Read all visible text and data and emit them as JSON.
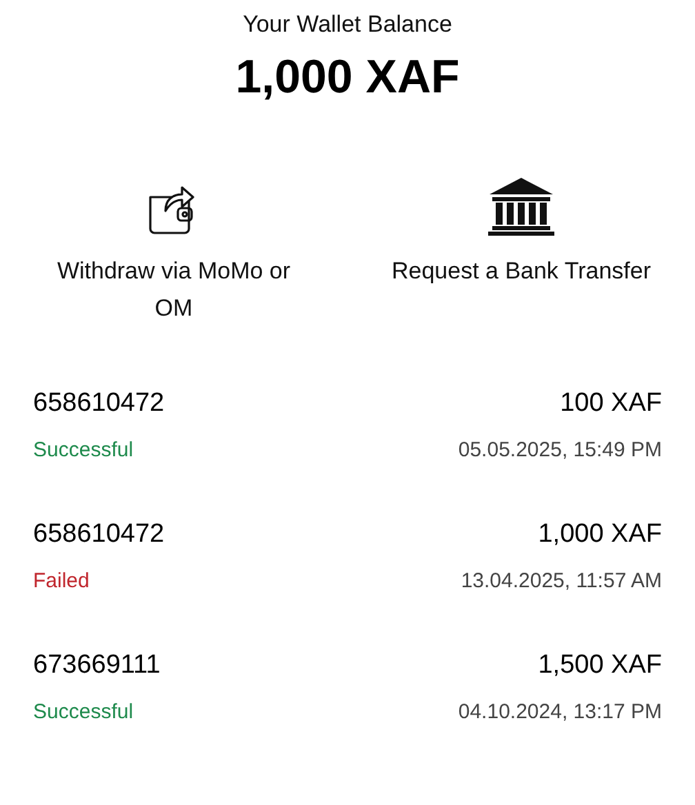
{
  "balance": {
    "label": "Your Wallet Balance",
    "amount": "1,000 XAF"
  },
  "actions": [
    {
      "kind": "wallet",
      "label": "Withdraw via MoMo or OM"
    },
    {
      "kind": "bank",
      "label": "Request a Bank Transfer"
    }
  ],
  "transactions": [
    {
      "number": "658610472",
      "amount": "100 XAF",
      "status": "Successful",
      "kind": "success",
      "date": "05.05.2025, 15:49 PM"
    },
    {
      "number": "658610472",
      "amount": "1,000 XAF",
      "status": "Failed",
      "kind": "failed",
      "date": "13.04.2025, 11:57 AM"
    },
    {
      "number": "673669111",
      "amount": "1,500 XAF",
      "status": "Successful",
      "kind": "success",
      "date": "04.10.2024, 13:17 PM"
    }
  ]
}
